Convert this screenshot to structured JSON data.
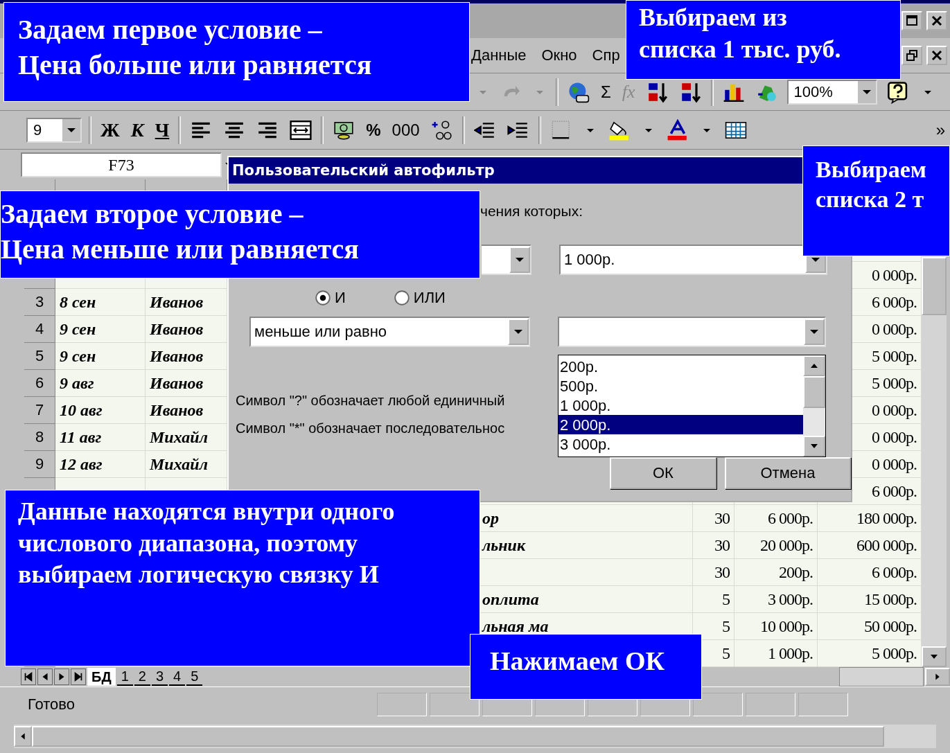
{
  "menu": [
    {
      "label": "Данные"
    },
    {
      "label": "Окно"
    },
    {
      "label": "Спр"
    }
  ],
  "toolbar_standard": {
    "sum_label": "Σ",
    "function_label": "fx",
    "zoom": "100%"
  },
  "toolbar_format": {
    "font_size": "9",
    "bold_label": "Ж",
    "italic_label": "К",
    "underline_label": "Ч",
    "percent_label": "%",
    "thousands_label": "000",
    "more_label": "»"
  },
  "name_box": "F73",
  "sheet": {
    "rows": [
      {
        "f": "0 000р."
      },
      {
        "num": "3",
        "a": "8 сен",
        "b": "Иванов",
        "f": "6 000р."
      },
      {
        "num": "4",
        "a": "9 сен",
        "b": "Иванов",
        "f": "0 000р."
      },
      {
        "num": "5",
        "a": "9 сен",
        "b": "Иванов",
        "f": "5 000р."
      },
      {
        "num": "6",
        "a": "9 авг",
        "b": "Иванов",
        "f": "5 000р."
      },
      {
        "num": "7",
        "a": "10 авг",
        "b": "Иванов",
        "f": "0 000р."
      },
      {
        "num": "8",
        "a": "11 авг",
        "b": "Михайл",
        "f": "0 000р."
      },
      {
        "num": "9",
        "a": "12 авг",
        "b": "Михайл",
        "f": "0 000р."
      },
      {
        "f": "6 000р."
      },
      {
        "c": "ор",
        "d": "30",
        "e": "6 000р.",
        "f": "180 000р."
      },
      {
        "c": "льник",
        "d": "30",
        "e": "20 000р.",
        "f": "600 000р."
      },
      {
        "d": "30",
        "e": "200р.",
        "f": "6 000р."
      },
      {
        "c": "оплита",
        "d": "5",
        "e": "3 000р.",
        "f": "15 000р."
      },
      {
        "c": "льная ма",
        "d": "5",
        "e": "10 000р.",
        "f": "50 000р."
      },
      {
        "d": "5",
        "e": "1 000р.",
        "f": "5 000р."
      }
    ]
  },
  "sheet_tabs": [
    {
      "label": "БД",
      "selected": true
    },
    {
      "label": "1",
      "selected": false
    },
    {
      "label": "2",
      "selected": false
    },
    {
      "label": "3",
      "selected": false
    },
    {
      "label": "4",
      "selected": false
    },
    {
      "label": "5",
      "selected": false
    }
  ],
  "status_bar": {
    "text": "Готово"
  },
  "dialog": {
    "title": "Пользовательский автофильтр",
    "prompt": "чения которых:",
    "condition_1": {
      "value": "1 000р."
    },
    "operators": [
      {
        "label": "И",
        "selected": true
      },
      {
        "label": "ИЛИ",
        "selected": false
      }
    ],
    "condition_2": {
      "operator": "меньше или равно"
    },
    "dropdown_options": [
      {
        "label": "200р.",
        "selected": false
      },
      {
        "label": "500р.",
        "selected": false
      },
      {
        "label": "1 000р.",
        "selected": false
      },
      {
        "label": "2 000р.",
        "selected": true
      },
      {
        "label": "3 000р.",
        "selected": false
      }
    ],
    "hints": [
      "Символ \"?\" обозначает любой единичный",
      "Символ \"*\" обозначает последовательнос"
    ],
    "buttons": [
      "ОК",
      "Отмена"
    ]
  },
  "callouts": [
    {
      "lines": [
        "Задаем первое условие –",
        "Цена больше или равняется"
      ]
    },
    {
      "lines": [
        "Выбираем из",
        "списка 1 тыс. руб."
      ]
    },
    {
      "lines": [
        "Выбираем",
        "списка 2 т"
      ]
    },
    {
      "lines": [
        "Задаем второе условие –",
        "Цена меньше или равняется"
      ]
    },
    {
      "lines": [
        "Данные находятся внутри одного",
        "числового диапазона, поэтому",
        "выбираем логическую связку И"
      ]
    },
    {
      "lines": [
        "Нажимаем ОК"
      ]
    }
  ]
}
